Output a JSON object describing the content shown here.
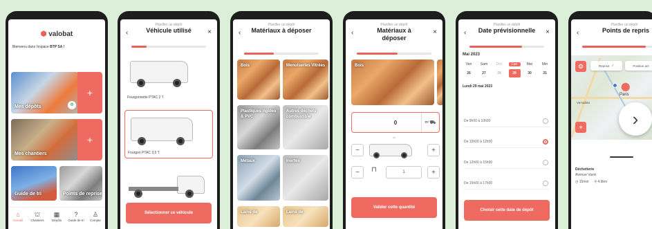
{
  "colors": {
    "accent": "#ef6b62",
    "background": "#dcefd9",
    "dark": "#1d1d1d"
  },
  "screen1": {
    "logo": "valobat",
    "welcome_prefix": "Bienvenu dans l'espace",
    "welcome_company": "BTP SA !",
    "tiles": [
      "Mes dépôts",
      "Mes chantiers",
      "Guide de tri",
      "Points de reprise"
    ],
    "plus": "+",
    "nav": [
      {
        "label": "Accueil",
        "icon": "⌂"
      },
      {
        "label": "Chantiers",
        "icon": "⛫"
      },
      {
        "label": "Dépôts",
        "icon": "▦"
      },
      {
        "label": "Guide de tri",
        "icon": "?"
      },
      {
        "label": "Compte",
        "icon": "♙"
      }
    ]
  },
  "screen2": {
    "subtitle": "Planifier un dépôt",
    "title": "Véhicule utilisé",
    "vehicles": [
      "Fourgonnette PTAC 2 T",
      "Fourgon PTAC 3,5 T",
      ""
    ],
    "cta": "Sélectionner ce véhicule"
  },
  "screen3": {
    "subtitle": "Planifier un dépôt",
    "title": "Matériaux à déposer",
    "materials": [
      "Bois",
      "Menuiseries Vitrées",
      "Plastiques rigides & PVC",
      "Autres déchets combustible",
      "Métaux",
      "Inertes",
      "Laine de",
      "Laine de"
    ]
  },
  "screen4": {
    "subtitle": "Planifier un dépôt",
    "title": "Matériaux à déposer",
    "material": "Bois",
    "quantity": "0",
    "unit": "m³",
    "or": "ou",
    "count": "1",
    "minus": "−",
    "plus": "+",
    "cta": "Valider cette quantité"
  },
  "screen5": {
    "subtitle": "Planifier un dépôt",
    "title": "Date prévisionnelle",
    "month": "Mai 2023",
    "days": [
      {
        "name": "Ven",
        "num": "26"
      },
      {
        "name": "Sam",
        "num": "27"
      },
      {
        "name": "Dim",
        "num": "28"
      },
      {
        "name": "Lun",
        "num": "29"
      },
      {
        "name": "Mar",
        "num": "30"
      },
      {
        "name": "Mer",
        "num": "31"
      }
    ],
    "selected_date": "Lundi 29 mai 2023",
    "slots": [
      "De 9h00 à 10h00",
      "De 10h00 à 12h00",
      "De 12h00 à 15h00",
      "De 15h00 à 17h00"
    ],
    "cta": "Choisir cette date de dépôt"
  },
  "screen6": {
    "subtitle": "Planifier un dépôt",
    "title": "Points de repris",
    "filters": [
      "Reprise",
      "Position act"
    ],
    "map_city": "Paris",
    "map_city2": "Versailles",
    "site_name": "Déchetterie",
    "site_address": "Avenue Vavin",
    "duration": "15min",
    "distance": "4.9km"
  },
  "next": "›"
}
